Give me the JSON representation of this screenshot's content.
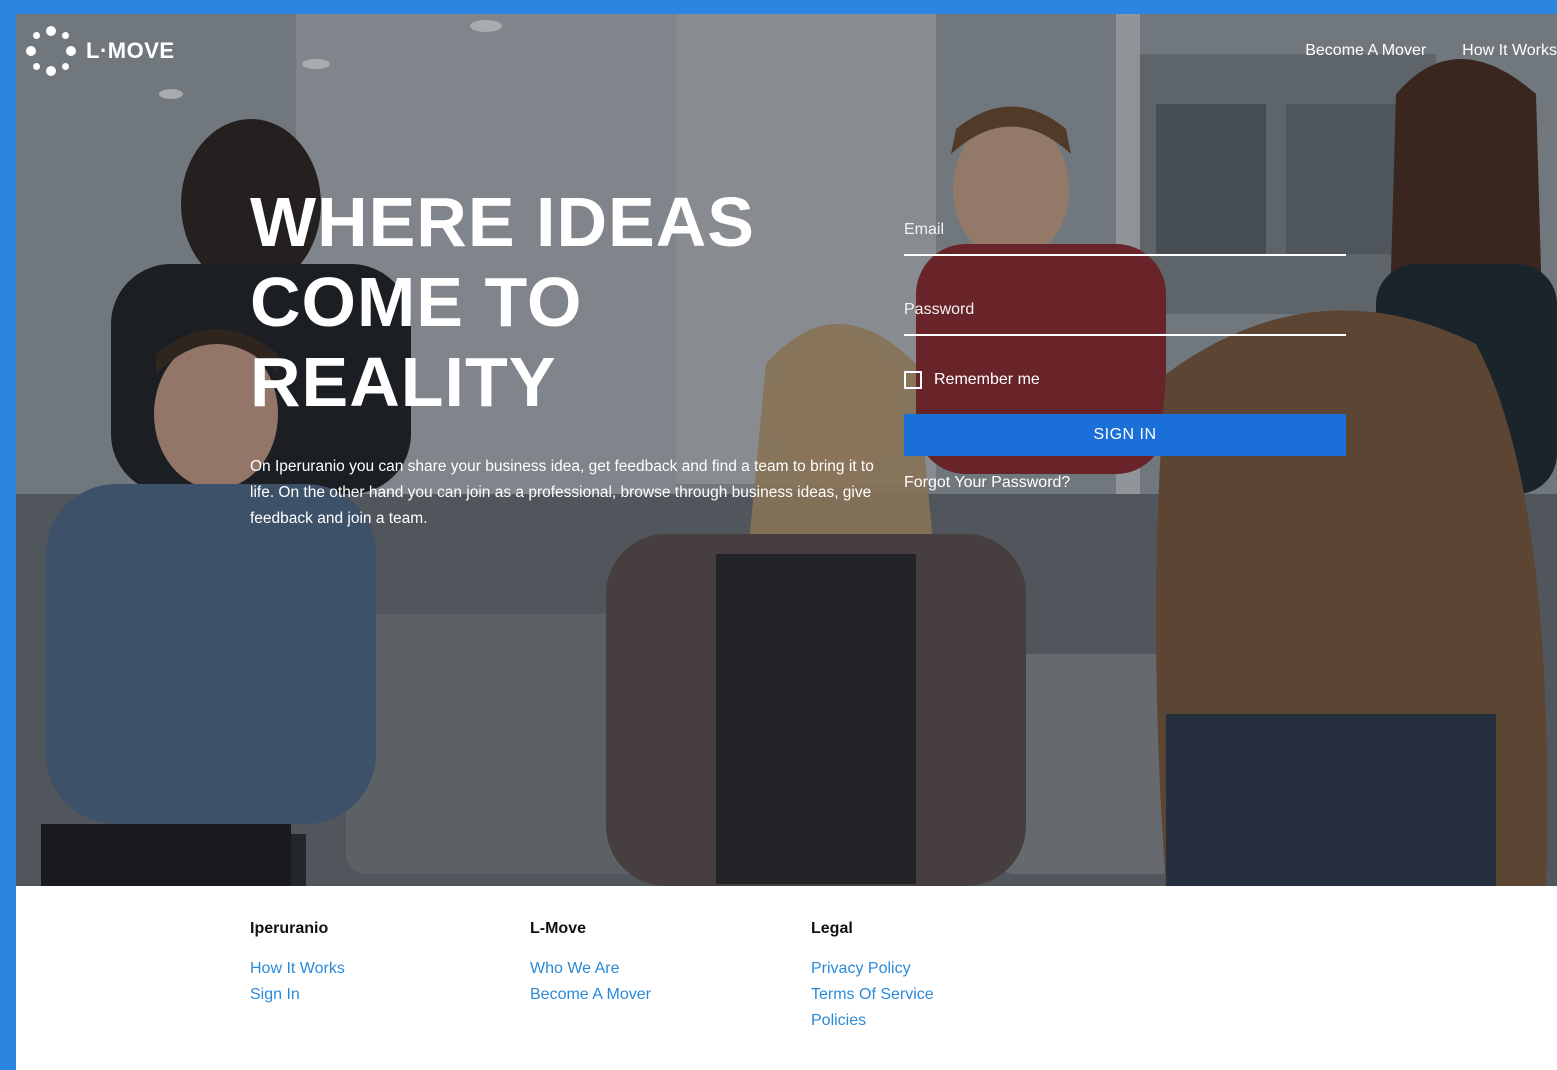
{
  "brand": {
    "name": "L·MOVE"
  },
  "nav": {
    "items": [
      {
        "label": "Become A Mover"
      },
      {
        "label": "How It Works"
      }
    ]
  },
  "hero": {
    "headline": {
      "line1": "WHERE IDEAS",
      "line2": "COME TO",
      "line3": "REALITY"
    },
    "intro": "On Iperuranio you can share your business idea, get feedback and find a team to bring it to life. On the other hand you can join as a professional, browse through business ideas, give feedback and join a team."
  },
  "login": {
    "email": {
      "placeholder": "Email",
      "value": ""
    },
    "password": {
      "placeholder": "Password",
      "value": ""
    },
    "remember_label": "Remember me",
    "remember_checked": false,
    "signin_label": "SIGN IN",
    "forgot_label": "Forgot Your Password?"
  },
  "footer": {
    "columns": [
      {
        "title": "Iperuranio",
        "links": [
          "How It Works",
          "Sign In"
        ]
      },
      {
        "title": "L-Move",
        "links": [
          "Who We Are",
          "Become A Mover"
        ]
      },
      {
        "title": "Legal",
        "links": [
          "Privacy Policy",
          "Terms Of Service",
          "Policies"
        ]
      }
    ]
  },
  "colors": {
    "frame_border": "#2a86e0",
    "primary_button": "#1b6fd8",
    "footer_link": "#2b8ad8",
    "footer_heading": "#111111"
  },
  "icons": {
    "logo": "dotted-circle-logo-icon",
    "checkbox": "checkbox-icon"
  }
}
